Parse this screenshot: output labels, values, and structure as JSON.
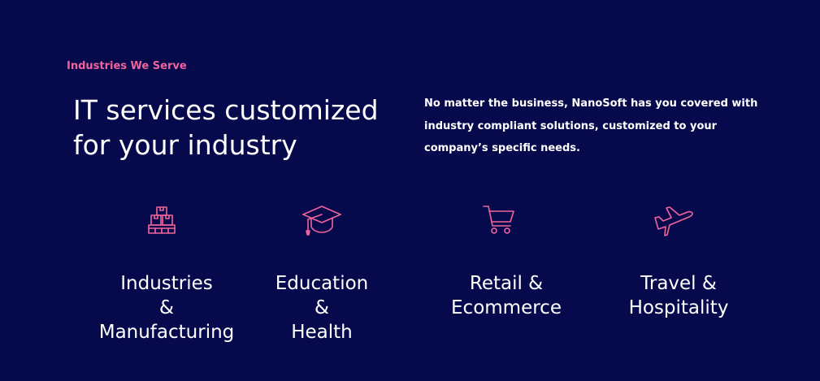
{
  "section": {
    "eyebrow": "Industries We Serve",
    "headline_lines": [
      "IT services customized",
      "for your industry"
    ],
    "description_lines": [
      "No matter the business, NanoSoft has you covered with",
      "industry compliant solutions, customized to your",
      "company’s specific needs."
    ]
  },
  "industries": [
    {
      "icon": "boxes-pallet-icon",
      "label_lines": [
        "Industries",
        "&",
        "Manufacturing"
      ]
    },
    {
      "icon": "graduation-cap-icon",
      "label_lines": [
        "Education",
        "&",
        "Health"
      ]
    },
    {
      "icon": "shopping-cart-icon",
      "label_lines": [
        "Retail &",
        "Ecommerce"
      ]
    },
    {
      "icon": "airplane-icon",
      "label_lines": [
        "Travel &",
        "Hospitality"
      ]
    }
  ],
  "colors": {
    "background": "#060a4d",
    "accent": "#f0649a",
    "text": "#ffffff"
  }
}
